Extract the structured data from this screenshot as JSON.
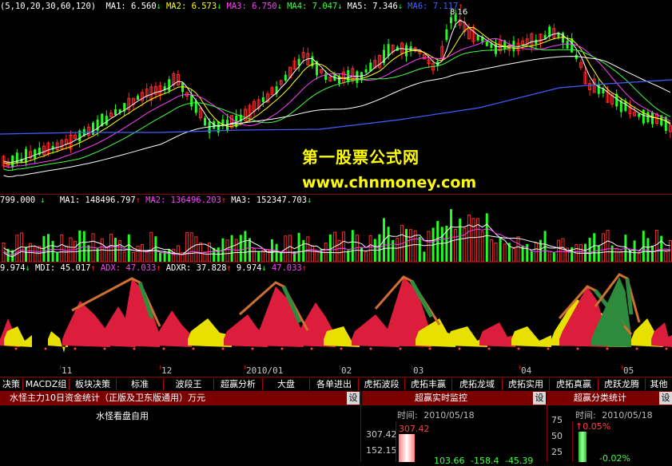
{
  "price_panel": {
    "params": "(5,10,20,30,60,120)",
    "mas": [
      {
        "label": "MA1:",
        "value": "6.560",
        "arrow": "↓",
        "color": "#ffffff"
      },
      {
        "label": "MA2:",
        "value": "6.573",
        "arrow": "↓",
        "color": "#ffff00"
      },
      {
        "label": "MA3:",
        "value": "6.750",
        "arrow": "↓",
        "color": "#ff40ff"
      },
      {
        "label": "MA4:",
        "value": "7.047",
        "arrow": "↓",
        "color": "#40ff40"
      },
      {
        "label": "MA5:",
        "value": "7.346",
        "arrow": "↓",
        "color": "#ffffff"
      },
      {
        "label": "MA6:",
        "value": "7.117",
        "arrow": "↑",
        "color": "#4060ff"
      }
    ],
    "high_label": "8.16"
  },
  "watermark": {
    "line1": "第一股票公式网",
    "line2": "www.chnmoney.com"
  },
  "volume_panel": {
    "vol": "799.000",
    "vol_arrow": "↓",
    "mas": [
      {
        "label": "MA1:",
        "value": "148496.797",
        "arrow": "↑",
        "color": "#ffffff"
      },
      {
        "label": "MA2:",
        "value": "136496.203",
        "arrow": "↑",
        "color": "#ff40ff"
      },
      {
        "label": "MA3:",
        "value": "152347.703",
        "arrow": "↓",
        "color": "#ffffff"
      }
    ]
  },
  "indicator_panel": {
    "items": [
      {
        "label": "",
        "value": "9.974",
        "arrow": "↓",
        "color": "#ffffff"
      },
      {
        "label": "MDI:",
        "value": "45.017",
        "arrow": "↑",
        "color": "#ffffff"
      },
      {
        "label": "ADX:",
        "value": "47.033",
        "arrow": "↑",
        "color": "#ff40ff"
      },
      {
        "label": "ADXR:",
        "value": "37.828",
        "arrow": "↑",
        "color": "#ffffff"
      },
      {
        "label": "",
        "value": "9.974",
        "arrow": "↓",
        "color": "#ffffff"
      },
      {
        "label": "",
        "value": "47.033",
        "arrow": "↑",
        "color": "#ff40ff"
      }
    ]
  },
  "x_axis": {
    "labels": [
      "11",
      "12",
      "2010/01",
      "02",
      "03",
      "04",
      "05"
    ]
  },
  "tabs": [
    "决策",
    "MACDZ组合",
    "板块决策",
    "标准",
    "波段王",
    "超赢分析",
    "大盘",
    "各单进出",
    "虎拓波段",
    "虎拓丰赢",
    "虎拓龙域",
    "虎拓实用",
    "虎拓真赢",
    "虎跃龙腾",
    "其他"
  ],
  "bottom": {
    "left": {
      "title": "水怪主力10日资金统计（正版及卫东版通用）万元",
      "set": "设",
      "body": "水怪看盘自用"
    },
    "mid": {
      "title": "超赢实时监控",
      "set": "设",
      "time_label": "时间:",
      "time_value": "2010/05/18",
      "y1": "307.42",
      "y2": "152.15",
      "bar_label": "307.42",
      "values": [
        "103.66",
        "-158.4",
        "-45.39"
      ]
    },
    "right": {
      "title": "超赢分类统计",
      "set": "设",
      "time_label": "时间:",
      "time_value": "2010/05/18",
      "y1": "75",
      "y2": "50",
      "y3": "25",
      "pos_label": "↑0.05%",
      "neg_label": "-0.02%"
    }
  },
  "colors": {
    "up": "#ff2020",
    "down": "#20ff20",
    "panel_separator": "#8a0000",
    "title_bar": "#7a0000",
    "indicator_red": "#dc1e3c",
    "indicator_yellow": "#e8e000",
    "indicator_green": "#2e8b3e"
  }
}
